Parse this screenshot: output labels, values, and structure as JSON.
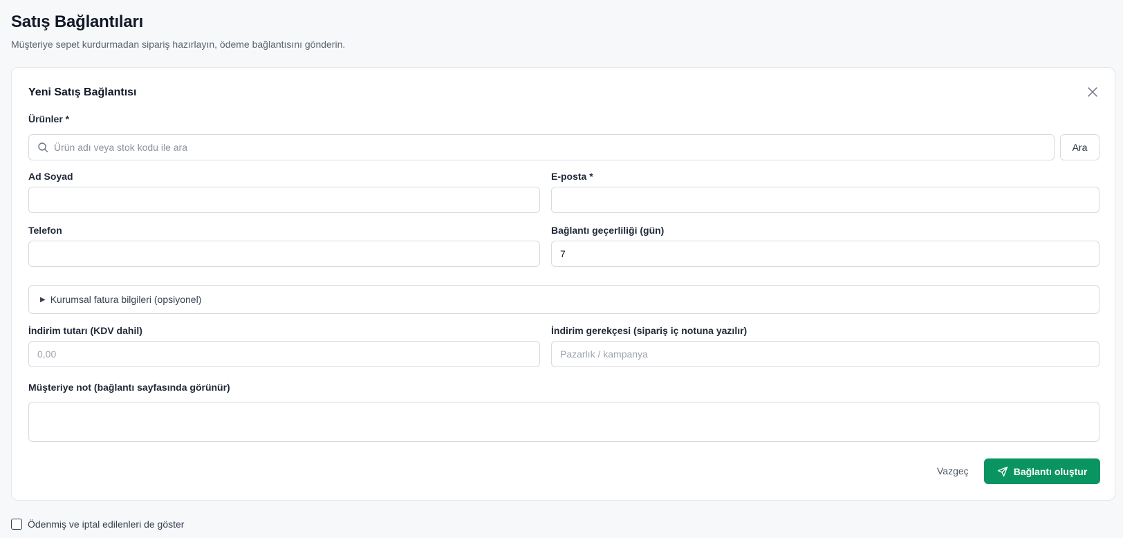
{
  "page": {
    "title": "Satış Bağlantıları",
    "subtitle": "Müşteriye sepet kurdurmadan sipariş hazırlayın, ödeme bağlantısını gönderin."
  },
  "form": {
    "title": "Yeni Satış Bağlantısı",
    "products": {
      "label": "Ürünler *",
      "placeholder": "Ürün adı veya stok kodu ile ara",
      "search_button": "Ara"
    },
    "name": {
      "label": "Ad Soyad",
      "value": ""
    },
    "email": {
      "label": "E-posta *",
      "value": ""
    },
    "phone": {
      "label": "Telefon",
      "value": ""
    },
    "validity": {
      "label": "Bağlantı geçerliliği (gün)",
      "value": "7"
    },
    "corporate_invoice": {
      "label": "Kurumsal fatura bilgileri (opsiyonel)"
    },
    "discount_amount": {
      "label": "İndirim tutarı (KDV dahil)",
      "placeholder": "0,00"
    },
    "discount_reason": {
      "label": "İndirim gerekçesi (sipariş iç notuna yazılır)",
      "placeholder": "Pazarlık / kampanya"
    },
    "customer_note": {
      "label": "Müşteriye not (bağlantı sayfasında görünür)",
      "value": ""
    },
    "cancel_label": "Vazgeç",
    "submit_label": "Bağlantı oluştur"
  },
  "filters": {
    "show_paid_cancelled_label": "Ödenmiş ve iptal edilenleri de göster",
    "show_paid_cancelled_checked": false
  },
  "colors": {
    "primary": "#0a9461",
    "background": "#f7f8f9",
    "border": "#d6dae0"
  },
  "icons": {
    "close": "close-icon",
    "search": "search-icon",
    "send": "send-icon",
    "caret": "caret-right-icon"
  }
}
